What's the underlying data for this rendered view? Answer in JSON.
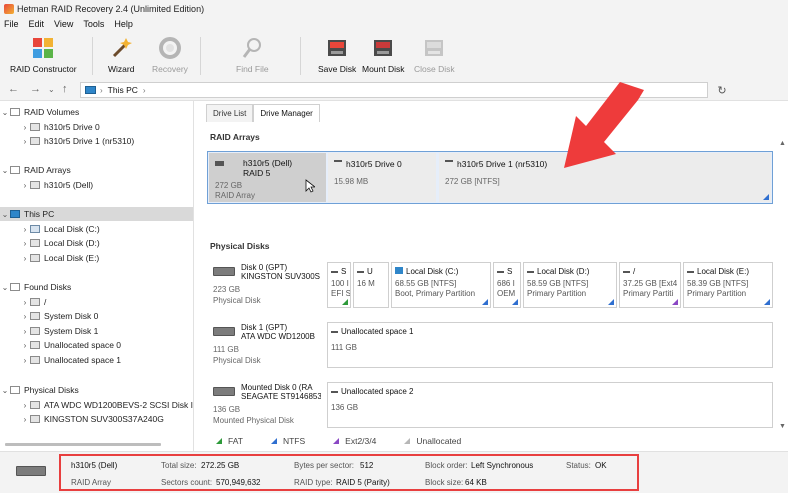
{
  "window": {
    "title": "Hetman RAID Recovery 2.4 (Unlimited Edition)"
  },
  "menu": [
    "File",
    "Edit",
    "View",
    "Tools",
    "Help"
  ],
  "toolbar": {
    "raid_constructor": "RAID Constructor",
    "wizard": "Wizard",
    "recovery": "Recovery",
    "find_file": "Find File",
    "save_disk": "Save Disk",
    "mount_disk": "Mount Disk",
    "close_disk": "Close Disk"
  },
  "address": {
    "crumb": "This PC"
  },
  "tree": {
    "raid_volumes": {
      "label": "RAID Volumes",
      "items": [
        "h310r5 Drive 0",
        "h310r5 Drive 1 (nr5310)"
      ]
    },
    "raid_arrays": {
      "label": "RAID Arrays",
      "items": [
        "h310r5 (Dell)"
      ]
    },
    "this_pc": {
      "label": "This PC",
      "items": [
        "Local Disk (C:)",
        "Local Disk (D:)",
        "Local Disk (E:)"
      ]
    },
    "found_disks": {
      "label": "Found Disks",
      "items": [
        "/",
        "System Disk 0",
        "System Disk 1",
        "Unallocated space 0",
        "Unallocated space 1"
      ]
    },
    "physical_disks": {
      "label": "Physical Disks",
      "items": [
        "ATA WDC WD1200BEVS-2 SCSI Disk I",
        "KINGSTON SUV300S37A240G"
      ]
    }
  },
  "tabs": [
    "Drive List",
    "Drive Manager"
  ],
  "raid_section": {
    "title": "RAID Arrays",
    "array": {
      "name": "h310r5 (Dell)",
      "level": "RAID 5",
      "size": "272 GB",
      "type": "RAID Array"
    },
    "cells": [
      {
        "name": "h310r5 Drive 0",
        "size": "15.98 MB"
      },
      {
        "name": "h310r5 Drive 1 (nr5310)",
        "size": "272 GB [NTFS]"
      }
    ]
  },
  "physical_section": {
    "title": "Physical Disks",
    "disks": [
      {
        "name": "Disk 0 (GPT)",
        "model": "KINGSTON SUV300S",
        "size": "223 GB",
        "type": "Physical Disk",
        "partitions": [
          {
            "name": "S",
            "size": "100 I",
            "type": "EFI S"
          },
          {
            "name": "U",
            "size": "16 M",
            "type": ""
          },
          {
            "name": "Local Disk (C:)",
            "size": "68.55 GB [NTFS]",
            "type": "Boot, Primary Partition"
          },
          {
            "name": "S",
            "size": "686 I",
            "type": "OEM"
          },
          {
            "name": "Local Disk (D:)",
            "size": "58.59 GB [NTFS]",
            "type": "Primary Partition"
          },
          {
            "name": "/",
            "size": "37.25 GB [Ext4",
            "type": "Primary Partiti"
          },
          {
            "name": "Local Disk (E:)",
            "size": "58.39 GB [NTFS]",
            "type": "Primary Partition"
          }
        ]
      },
      {
        "name": "Disk 1 (GPT)",
        "model": "ATA WDC WD1200B",
        "size": "111 GB",
        "type": "Physical Disk",
        "partitions": [
          {
            "name": "Unallocated space 1",
            "size": "111 GB",
            "type": ""
          }
        ]
      },
      {
        "name": "Mounted Disk 0 (RA",
        "model": "SEAGATE ST9146853",
        "size": "136 GB",
        "type": "Mounted Physical Disk",
        "partitions": [
          {
            "name": "Unallocated space 2",
            "size": "136 GB",
            "type": ""
          }
        ]
      }
    ]
  },
  "legend": [
    "FAT",
    "NTFS",
    "Ext2/3/4",
    "Unallocated"
  ],
  "status": {
    "name": "h310r5 (Dell)",
    "type": "RAID Array",
    "total_size_label": "Total size:",
    "total_size": "272.25 GB",
    "sectors_label": "Sectors count:",
    "sectors": "570,949,632",
    "bps_label": "Bytes per sector:",
    "bps": "512",
    "raid_type_label": "RAID type:",
    "raid_type": "RAID 5 (Parity)",
    "block_order_label": "Block order:",
    "block_order": "Left Synchronous",
    "block_size_label": "Block size:",
    "block_size": "64 KB",
    "status_label": "Status:",
    "status": "OK"
  },
  "colors": {
    "accent": "#2f6fd0",
    "annotation": "#e83f3f",
    "selection": "#e6eefa"
  }
}
